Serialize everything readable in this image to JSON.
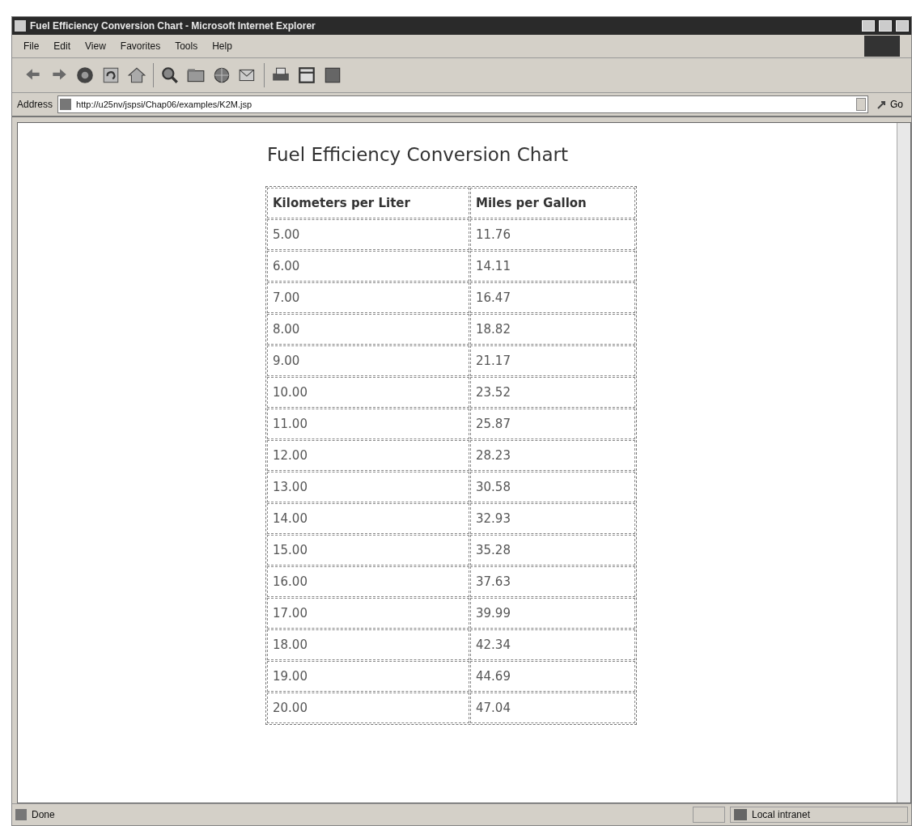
{
  "window": {
    "title": "Fuel Efficiency Conversion Chart - Microsoft Internet Explorer"
  },
  "menu": [
    "File",
    "Edit",
    "View",
    "Favorites",
    "Tools",
    "Help"
  ],
  "address_bar": {
    "label": "Address",
    "value": "http://u25nv/jspsi/Chap06/examples/K2M.jsp",
    "go": "Go"
  },
  "page": {
    "heading": "Fuel Efficiency Conversion Chart",
    "table": {
      "columns": [
        "Kilometers per Liter",
        "Miles per Gallon"
      ],
      "rows": [
        [
          "5.00",
          "11.76"
        ],
        [
          "6.00",
          "14.11"
        ],
        [
          "7.00",
          "16.47"
        ],
        [
          "8.00",
          "18.82"
        ],
        [
          "9.00",
          "21.17"
        ],
        [
          "10.00",
          "23.52"
        ],
        [
          "11.00",
          "25.87"
        ],
        [
          "12.00",
          "28.23"
        ],
        [
          "13.00",
          "30.58"
        ],
        [
          "14.00",
          "32.93"
        ],
        [
          "15.00",
          "35.28"
        ],
        [
          "16.00",
          "37.63"
        ],
        [
          "17.00",
          "39.99"
        ],
        [
          "18.00",
          "42.34"
        ],
        [
          "19.00",
          "44.69"
        ],
        [
          "20.00",
          "47.04"
        ]
      ]
    }
  },
  "status_bar": {
    "text": "Done",
    "zone": "Local intranet"
  }
}
